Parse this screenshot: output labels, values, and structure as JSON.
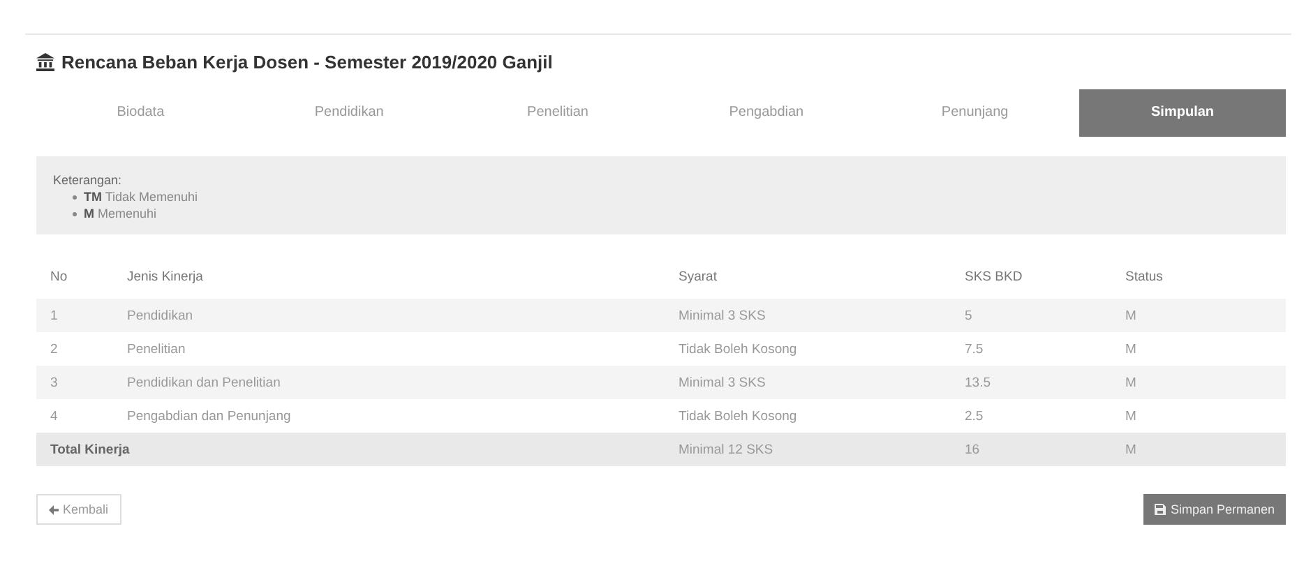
{
  "title": "Rencana Beban Kerja Dosen - Semester 2019/2020 Ganjil",
  "tabs": [
    {
      "label": "Biodata",
      "selected": false
    },
    {
      "label": "Pendidikan",
      "selected": false
    },
    {
      "label": "Penelitian",
      "selected": false
    },
    {
      "label": "Pengabdian",
      "selected": false
    },
    {
      "label": "Penunjang",
      "selected": false
    },
    {
      "label": "Simpulan",
      "selected": true
    }
  ],
  "legend": {
    "heading": "Keterangan:",
    "items": [
      {
        "code": "TM",
        "text": "Tidak Memenuhi"
      },
      {
        "code": "M",
        "text": "Memenuhi"
      }
    ]
  },
  "table": {
    "columns": [
      "No",
      "Jenis Kinerja",
      "Syarat",
      "SKS BKD",
      "Status"
    ],
    "rows": [
      {
        "no": "1",
        "jenis": "Pendidikan",
        "syarat": "Minimal 3 SKS",
        "sks": "5",
        "status": "M"
      },
      {
        "no": "2",
        "jenis": "Penelitian",
        "syarat": "Tidak Boleh Kosong",
        "sks": "7.5",
        "status": "M"
      },
      {
        "no": "3",
        "jenis": "Pendidikan dan Penelitian",
        "syarat": "Minimal 3 SKS",
        "sks": "13.5",
        "status": "M"
      },
      {
        "no": "4",
        "jenis": "Pengabdian dan Penunjang",
        "syarat": "Tidak Boleh Kosong",
        "sks": "2.5",
        "status": "M"
      }
    ],
    "total": {
      "label": "Total Kinerja",
      "syarat": "Minimal 12 SKS",
      "sks": "16",
      "status": "M"
    }
  },
  "buttons": {
    "back": "Kembali",
    "save": "Simpan Permanen"
  }
}
